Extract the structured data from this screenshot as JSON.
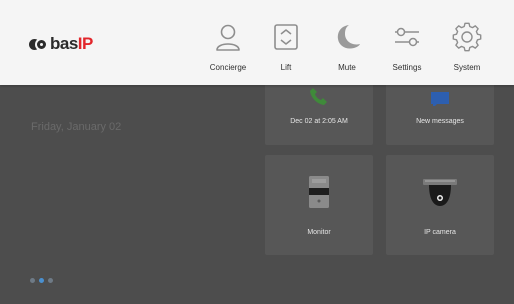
{
  "colors": {
    "topbar_bg": "#f5f5f5",
    "screen_bg": "#4d4d4d",
    "tile_bg": "#575757",
    "icon_gray": "#8e8e8e",
    "logo_accent": "#e2262b",
    "dot_active": "#4a90d0"
  },
  "logo": {
    "prefix": "bas",
    "accent": "IP"
  },
  "nav": [
    {
      "label": "Concierge",
      "icon": "person-icon"
    },
    {
      "label": "Lift",
      "icon": "elevator-icon"
    },
    {
      "label": "Mute",
      "icon": "moon-icon"
    },
    {
      "label": "Settings",
      "icon": "sliders-icon"
    },
    {
      "label": "System",
      "icon": "gear-icon"
    }
  ],
  "dashboard": {
    "date": "Friday, January 02",
    "tiles": [
      {
        "label": "Dec 02 at 2:05 AM",
        "icon": "phone-icon"
      },
      {
        "label": "New messages",
        "icon": "message-icon"
      },
      {
        "label": "Monitor",
        "icon": "intercom-panel-icon"
      },
      {
        "label": "IP camera",
        "icon": "dome-camera-icon"
      }
    ],
    "pager": {
      "pages": 3,
      "active": 2
    }
  }
}
